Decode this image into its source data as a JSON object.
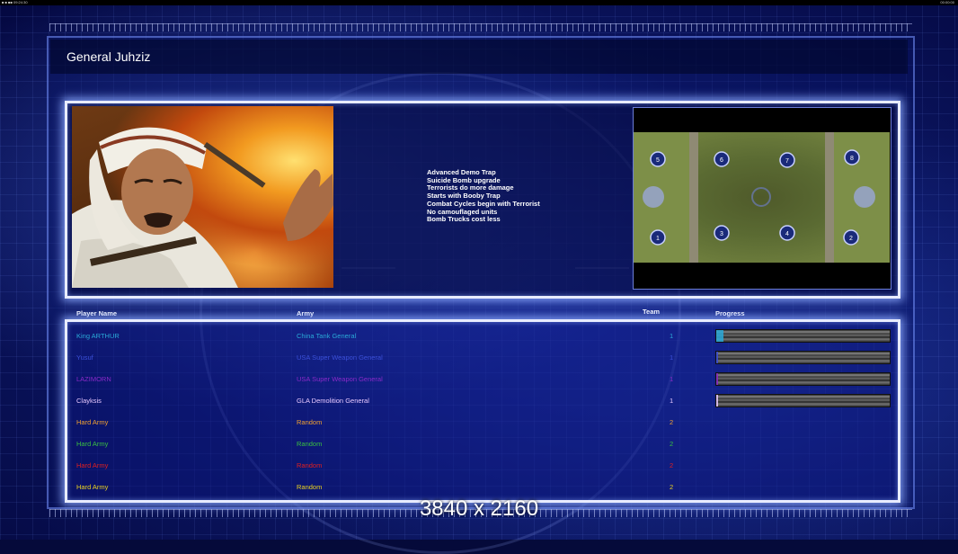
{
  "status_bar": {
    "left": "■ ■ ■■  09:24:30",
    "right": "00:00:00"
  },
  "header": {
    "title": "General Juhziz"
  },
  "general": {
    "traits": [
      "Advanced Demo Trap",
      "Suicide Bomb upgrade",
      "Terrorists do more damage",
      "Starts with Booby Trap",
      "Combat Cycles begin with Terrorist",
      "No camouflaged units",
      "Bomb Trucks cost less"
    ]
  },
  "minimap": {
    "start_positions": [
      "1",
      "2",
      "3",
      "4",
      "5",
      "6",
      "7",
      "8"
    ]
  },
  "table": {
    "headers": {
      "player_name": "Player Name",
      "army": "Army",
      "team": "Team",
      "progress": "Progress"
    },
    "rows": [
      {
        "name": "King ARTHUR",
        "army": "China Tank General",
        "team": "1",
        "color": "#2aa9d8",
        "progress": 0.04
      },
      {
        "name": "Yusuf",
        "army": "USA Super Weapon General",
        "team": "1",
        "color": "#3b4fd8",
        "progress": 0.01
      },
      {
        "name": "LAZIMORN",
        "army": "USA Super Weapon General",
        "team": "1",
        "color": "#8a2ac8",
        "progress": 0.01
      },
      {
        "name": "Clayksis",
        "army": "GLA Demolition General",
        "team": "1",
        "color": "#e6c8ff",
        "progress": 0.01
      },
      {
        "name": "Hard Army",
        "army": "Random",
        "team": "2",
        "color": "#f0a030",
        "progress": null
      },
      {
        "name": "Hard Army",
        "army": "Random",
        "team": "2",
        "color": "#3ac040",
        "progress": null
      },
      {
        "name": "Hard Army",
        "army": "Random",
        "team": "2",
        "color": "#e02020",
        "progress": null
      },
      {
        "name": "Hard Army",
        "army": "Random",
        "team": "2",
        "color": "#e8d020",
        "progress": null
      }
    ]
  },
  "watermark": "3840 x 2160"
}
